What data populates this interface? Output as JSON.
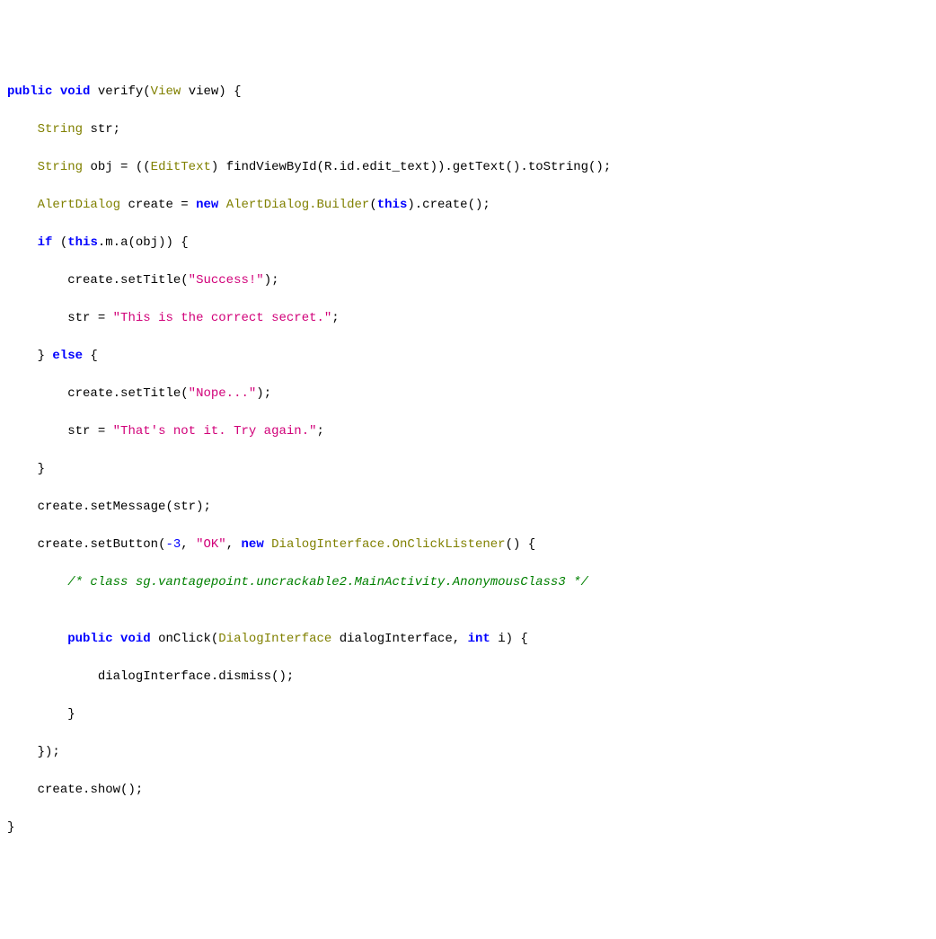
{
  "code": {
    "line1": {
      "kw1": "public",
      "kw2": "void",
      "name": "verify",
      "type1": "View",
      "param": "view"
    },
    "line2": {
      "type": "String",
      "var": "str"
    },
    "line3": {
      "type": "String",
      "var": "obj",
      "cast": "EditText",
      "call1": "findViewById",
      "arg": "R.id.edit_text",
      "call2": "getText",
      "call3": "toString"
    },
    "line4": {
      "type": "AlertDialog",
      "var": "create",
      "kw": "new",
      "builder": "AlertDialog.Builder",
      "this": "this",
      "call": "create"
    },
    "line5": {
      "kw": "if",
      "this": "this",
      "field": "m",
      "method": "a",
      "arg": "obj"
    },
    "line6": {
      "obj": "create",
      "method": "setTitle",
      "str": "\"Success!\""
    },
    "line7": {
      "var": "str",
      "str": "\"This is the correct secret.\""
    },
    "line8": {
      "kw": "else"
    },
    "line9": {
      "obj": "create",
      "method": "setTitle",
      "str": "\"Nope...\""
    },
    "line10": {
      "var": "str",
      "str": "\"That's not it. Try again.\""
    },
    "line11": {
      "obj": "create",
      "method": "setMessage",
      "arg": "str"
    },
    "line12": {
      "obj": "create",
      "method": "setButton",
      "num": "-3",
      "str": "\"OK\"",
      "kw": "new",
      "type": "DialogInterface.OnClickListener"
    },
    "line13": {
      "comment": "/* class sg.vantagepoint.uncrackable2.MainActivity.AnonymousClass3 */"
    },
    "line14": {
      "kw1": "public",
      "kw2": "void",
      "name": "onClick",
      "type1": "DialogInterface",
      "param1": "dialogInterface",
      "type2": "int",
      "param2": "i"
    },
    "line15": {
      "obj": "dialogInterface",
      "method": "dismiss"
    },
    "line16": {
      "obj": "create",
      "method": "show"
    }
  }
}
